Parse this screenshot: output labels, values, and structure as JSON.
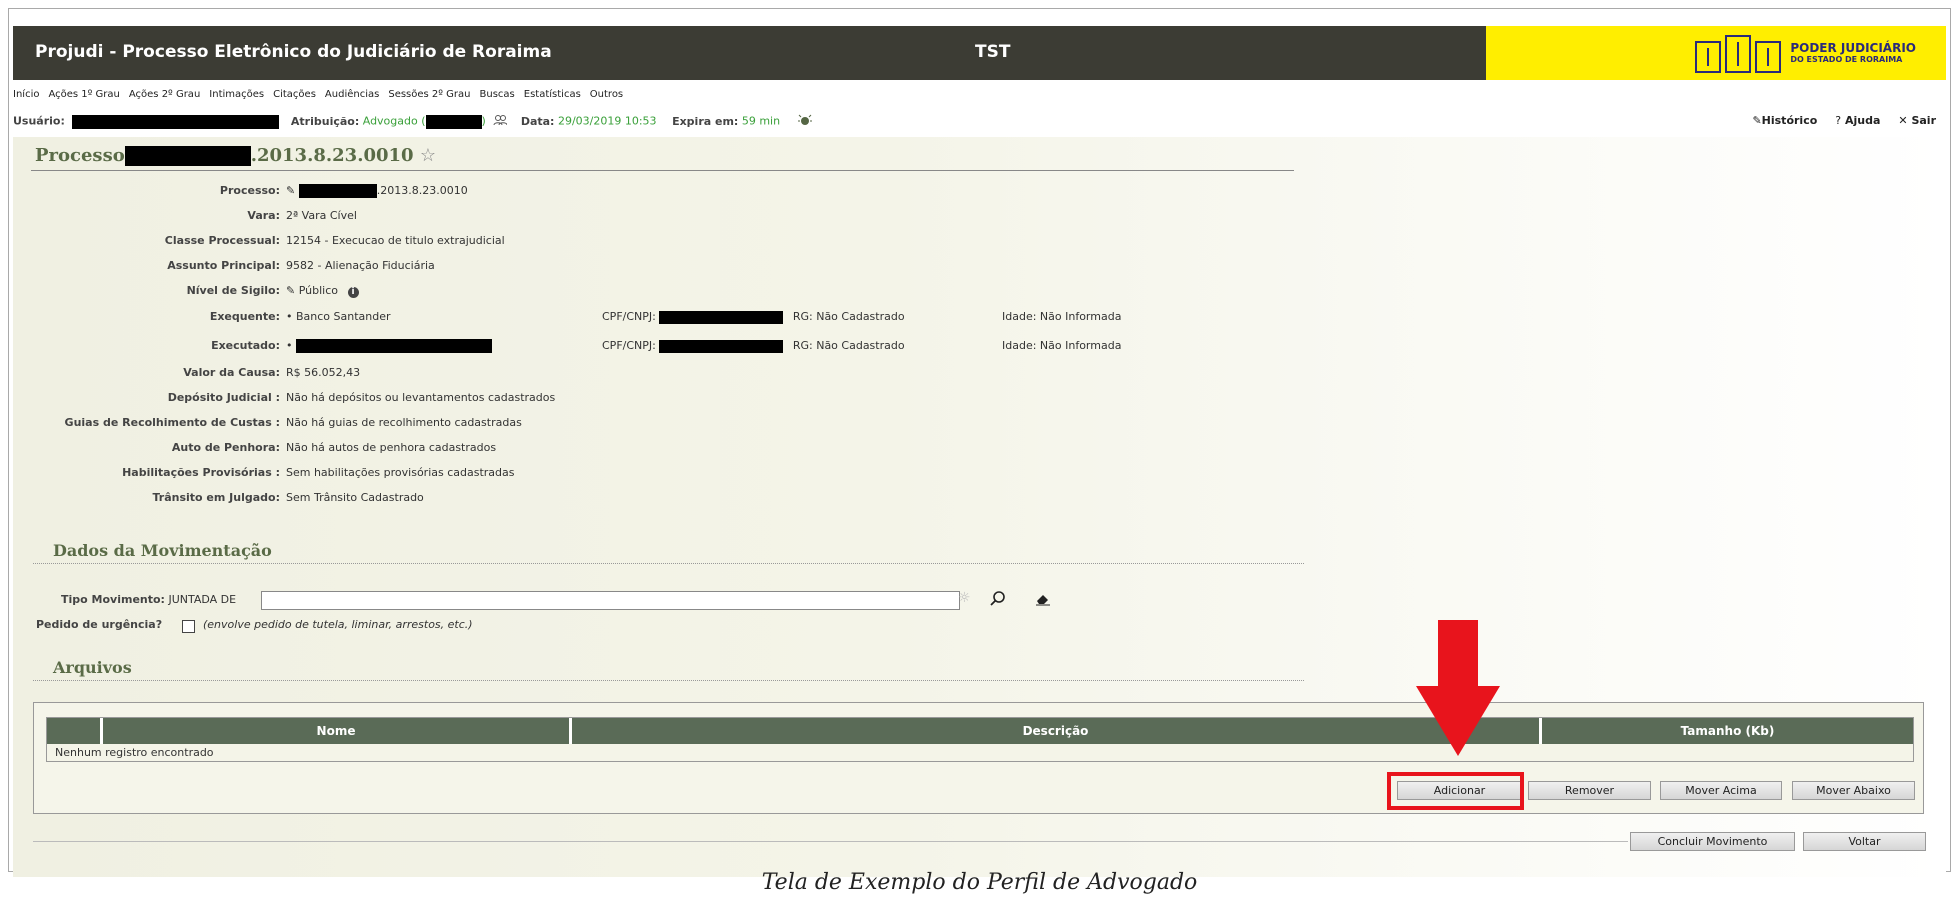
{
  "header": {
    "app_title": "Projudi - Processo Eletrônico do Judiciário de Roraima",
    "env_label": "TST",
    "logo_line1": "PODER JUDICIÁRIO",
    "logo_line2": "DO ESTADO DE RORAIMA"
  },
  "menu": [
    "Início",
    "Ações 1º Grau",
    "Ações 2º Grau",
    "Intimações",
    "Citações",
    "Audiências",
    "Sessões 2º Grau",
    "Buscas",
    "Estatísticas",
    "Outros"
  ],
  "userline": {
    "user_label": "Usuário:",
    "role_label": "Atribuição:",
    "role_value": "Advogado (",
    "role_close": ")",
    "date_label": "Data:",
    "date_value": "29/03/2019 10:53",
    "expires_label": "Expira em:",
    "expires_value": "59 min",
    "history": "Histórico",
    "help": "Ajuda",
    "exit": "Sair"
  },
  "process": {
    "title_prefix": "Processo",
    "title_suffix": ".2013.8.23.0010",
    "fields": {
      "processo": {
        "label": "Processo:",
        "value": ".2013.8.23.0010"
      },
      "vara": {
        "label": "Vara:",
        "value": "2ª Vara Cível"
      },
      "classe": {
        "label": "Classe Processual:",
        "value": "12154 - Execucao de titulo extrajudicial"
      },
      "assunto": {
        "label": "Assunto Principal:",
        "value": "9582 - Alienação Fiduciária"
      },
      "sigilo": {
        "label": "Nível de Sigilo:",
        "value": "Público"
      },
      "exequente": {
        "label": "Exequente:",
        "value": "Banco Santander",
        "cpf_label": "CPF/CNPJ:",
        "rg": "RG: Não Cadastrado",
        "idade": "Idade: Não Informada"
      },
      "executado": {
        "label": "Executado:",
        "cpf_label": "CPF/CNPJ:",
        "rg": "RG: Não Cadastrado",
        "idade": "Idade: Não Informada"
      },
      "valor": {
        "label": "Valor da Causa:",
        "value": "R$ 56.052,43"
      },
      "deposito": {
        "label": "Depósito Judicial :",
        "value": "Não há depósitos ou levantamentos cadastrados"
      },
      "guias": {
        "label": "Guias de Recolhimento de Custas :",
        "value": "Não há guias de recolhimento cadastradas"
      },
      "penhora": {
        "label": "Auto de Penhora:",
        "value": "Não há autos de penhora cadastrados"
      },
      "habilitacoes": {
        "label": "Habilitações Provisórias :",
        "value": "Sem habilitações provisórias cadastradas"
      },
      "transito": {
        "label": "Trânsito em Julgado:",
        "value": "Sem Trânsito Cadastrado"
      }
    }
  },
  "movimentacao": {
    "section_title": "Dados da Movimentação",
    "tipo_label": "Tipo Movimento:",
    "tipo_prefix": "JUNTADA DE",
    "tipo_value": "",
    "urgencia_label": "Pedido de urgência?",
    "urgencia_hint": "(envolve pedido de tutela, liminar, arrestos, etc.)"
  },
  "arquivos": {
    "section_title": "Arquivos",
    "columns": [
      "",
      "Nome",
      "Descrição",
      "Tamanho (Kb)"
    ],
    "empty_text": "Nenhum registro encontrado",
    "buttons": {
      "add": "Adicionar",
      "remove": "Remover",
      "up": "Mover Acima",
      "down": "Mover Abaixo"
    }
  },
  "footer_buttons": {
    "conclude": "Concluir Movimento",
    "back": "Voltar"
  },
  "caption": "Tela de Exemplo do Perfil de Advogado",
  "colors": {
    "header_bg": "#3c3c34",
    "logo_bg": "#ffee00",
    "accent_green": "#5a6b47",
    "highlight_red": "#e8141c"
  }
}
